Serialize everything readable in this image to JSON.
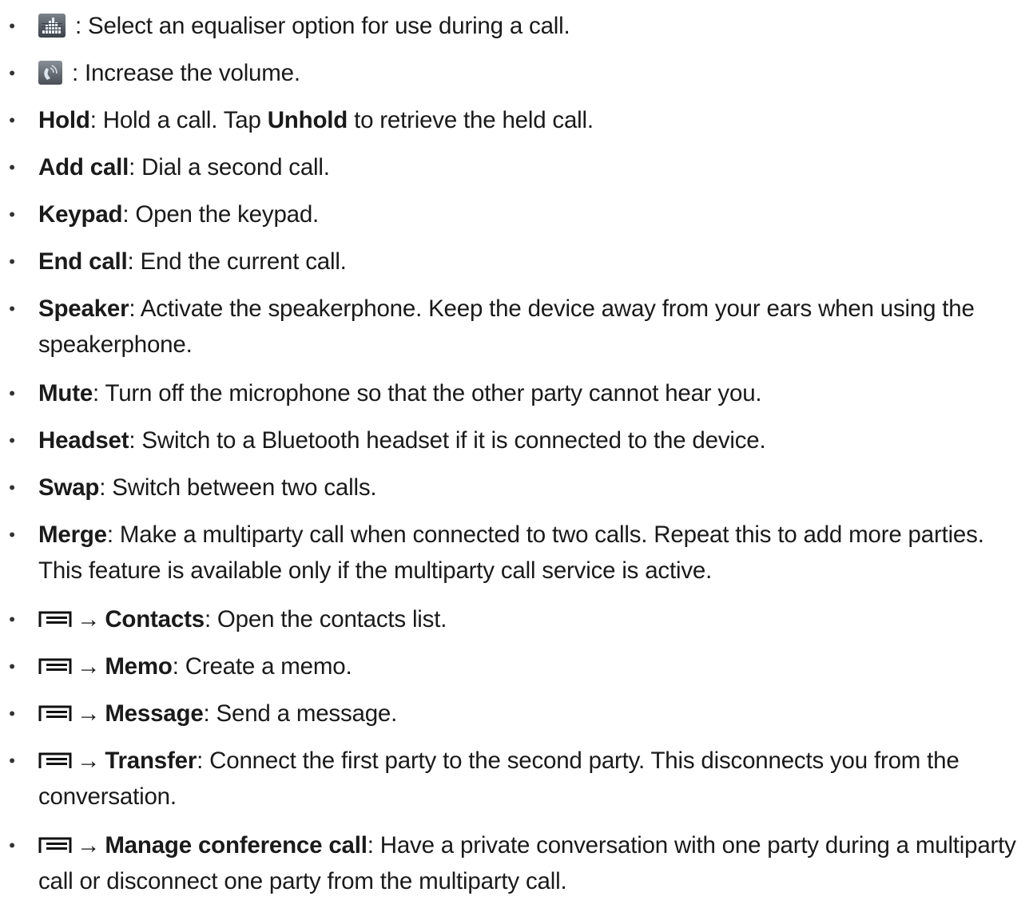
{
  "items": [
    {
      "icon": "equaliser-icon",
      "text": " : Select an equaliser option for use during a call."
    },
    {
      "icon": "volume-icon",
      "text": " : Increase the volume."
    },
    {
      "bold": "Hold",
      "text_a": ": Hold a call. Tap ",
      "bold2": "Unhold",
      "text_b": " to retrieve the held call."
    },
    {
      "bold": "Add call",
      "text": ": Dial a second call."
    },
    {
      "bold": "Keypad",
      "text": ": Open the keypad."
    },
    {
      "bold": "End call",
      "text": ": End the current call."
    },
    {
      "bold": "Speaker",
      "text": ": Activate the speakerphone. Keep the device away from your ears when using the speakerphone."
    },
    {
      "bold": "Mute",
      "text": ": Turn off the microphone so that the other party cannot hear you."
    },
    {
      "bold": "Headset",
      "text": ": Switch to a Bluetooth headset if it is connected to the device."
    },
    {
      "bold": "Swap",
      "text": ": Switch between two calls."
    },
    {
      "bold": "Merge",
      "text": ": Make a multiparty call when connected to two calls. Repeat this to add more parties. This feature is available only if the multiparty call service is active."
    },
    {
      "icon": "menu-icon",
      "arrow": "→",
      "bold": "Contacts",
      "text": ": Open the contacts list."
    },
    {
      "icon": "menu-icon",
      "arrow": "→",
      "bold": "Memo",
      "text": ": Create a memo."
    },
    {
      "icon": "menu-icon",
      "arrow": "→",
      "bold": "Message",
      "text": ": Send a message."
    },
    {
      "icon": "menu-icon",
      "arrow": "→",
      "bold": "Transfer",
      "text": ": Connect the first party to the second party. This disconnects you from the conversation."
    },
    {
      "icon": "menu-icon",
      "arrow": "→",
      "bold": "Manage conference call",
      "text": ": Have a private conversation with one party during a multiparty call or disconnect one party from the multiparty call."
    }
  ],
  "bullet": "•"
}
